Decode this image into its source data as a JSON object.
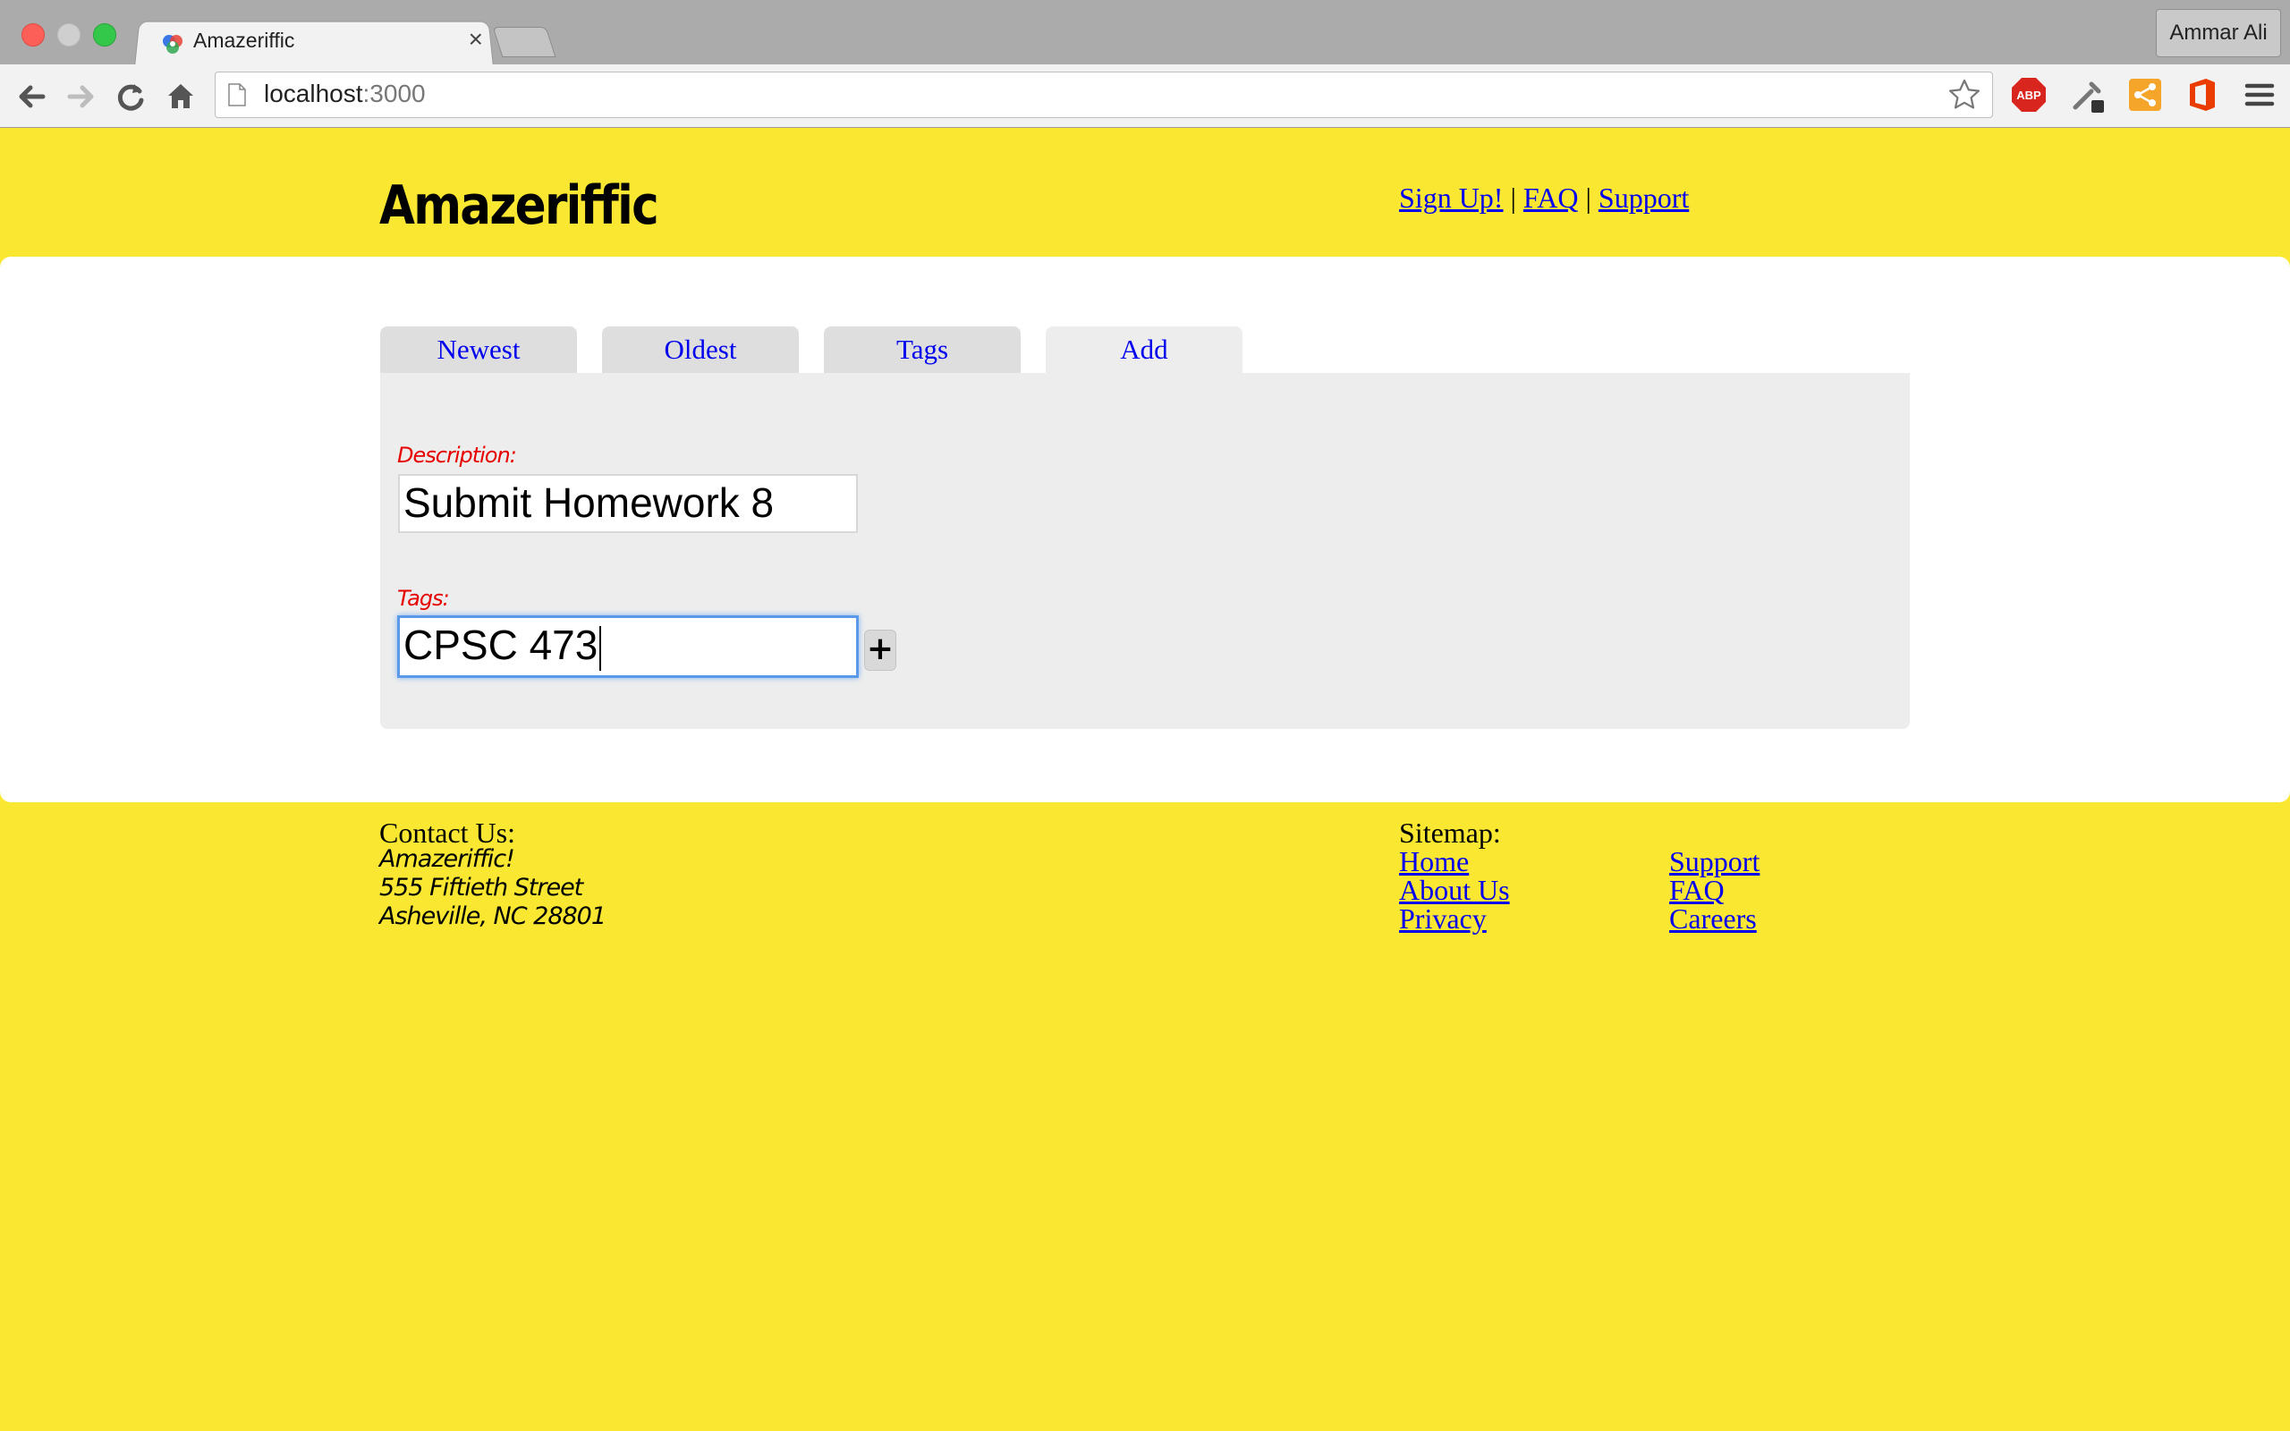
{
  "browser": {
    "tab_title": "Amazeriffic",
    "tab_close": "×",
    "profile_name": "Ammar Ali",
    "url_host": "localhost",
    "url_port": ":3000"
  },
  "header": {
    "title": "Amazeriffic",
    "links": [
      "Sign Up!",
      "FAQ",
      "Support"
    ],
    "separator": "|"
  },
  "tabs": [
    {
      "label": "Newest",
      "active": false
    },
    {
      "label": "Oldest",
      "active": false
    },
    {
      "label": "Tags",
      "active": false
    },
    {
      "label": "Add",
      "active": true
    }
  ],
  "form": {
    "description_label": "Description:",
    "description_value": "Submit Homework 8",
    "tags_label": "Tags:",
    "tags_value": "CPSC 473",
    "add_button": "+"
  },
  "footer": {
    "contact_heading": "Contact Us:",
    "contact_lines": [
      "Amazeriffic!",
      "555 Fiftieth Street",
      "Asheville, NC 28801"
    ],
    "sitemap_heading": "Sitemap:",
    "sitemap_col1": [
      "Home",
      "About Us",
      "Privacy"
    ],
    "sitemap_col2": [
      "Support",
      "FAQ",
      "Careers"
    ]
  },
  "colors": {
    "page_background": "#f9e732",
    "link": "#0000ee",
    "label": "#e60000"
  }
}
